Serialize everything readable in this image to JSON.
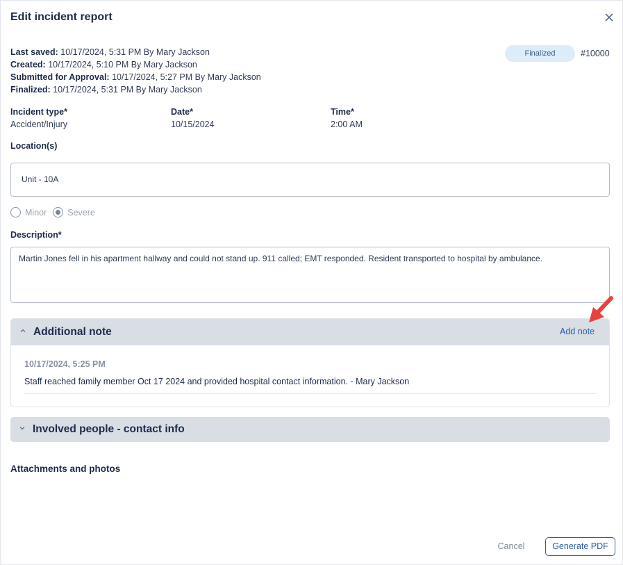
{
  "dialog": {
    "title": "Edit incident report"
  },
  "meta": [
    {
      "key": "Last saved:",
      "value": " 10/17/2024, 5:31 PM By Mary Jackson"
    },
    {
      "key": "Created:",
      "value": " 10/17/2024, 5:10 PM By Mary Jackson"
    },
    {
      "key": "Submitted for Approval:",
      "value": " 10/17/2024, 5:27 PM By Mary Jackson"
    },
    {
      "key": "Finalized:",
      "value": " 10/17/2024, 5:31 PM By Mary Jackson"
    }
  ],
  "status": {
    "badge": "Finalized",
    "id": "#10000"
  },
  "fields": {
    "incident_type": {
      "label": "Incident type*",
      "value": "Accident/Injury"
    },
    "date": {
      "label": "Date*",
      "value": "10/15/2024"
    },
    "time": {
      "label": "Time*",
      "value": "2:00 AM"
    }
  },
  "location": {
    "label": "Location(s)",
    "value": "Unit - 10A"
  },
  "severity": {
    "options": [
      "Minor",
      "Severe"
    ],
    "selected": "Severe"
  },
  "description": {
    "label": "Description*",
    "value": "Martin Jones fell in his apartment hallway and could not stand up. 911 called; EMT responded. Resident transported to hospital by ambulance."
  },
  "additional_note": {
    "title": "Additional note",
    "add_label": "Add note",
    "notes": [
      {
        "date": "10/17/2024, 5:25 PM",
        "text": "Staff reached family member Oct 17 2024 and provided hospital contact information. - Mary Jackson"
      }
    ]
  },
  "involved_people": {
    "title": "Involved people - contact info"
  },
  "attachments": {
    "title": "Attachments and photos"
  },
  "footer": {
    "cancel_label": "Cancel",
    "generate_label": "Generate PDF"
  },
  "colors": {
    "accent": "#2a5ea8",
    "badge_bg": "#dcecf9",
    "section_bg": "#d9dde4",
    "annotation_arrow": "#e8423f"
  },
  "icons": {
    "close": "close-icon",
    "collapse": "chevron-up-icon",
    "expand": "chevron-down-icon",
    "pointer": "red-arrow-icon"
  }
}
